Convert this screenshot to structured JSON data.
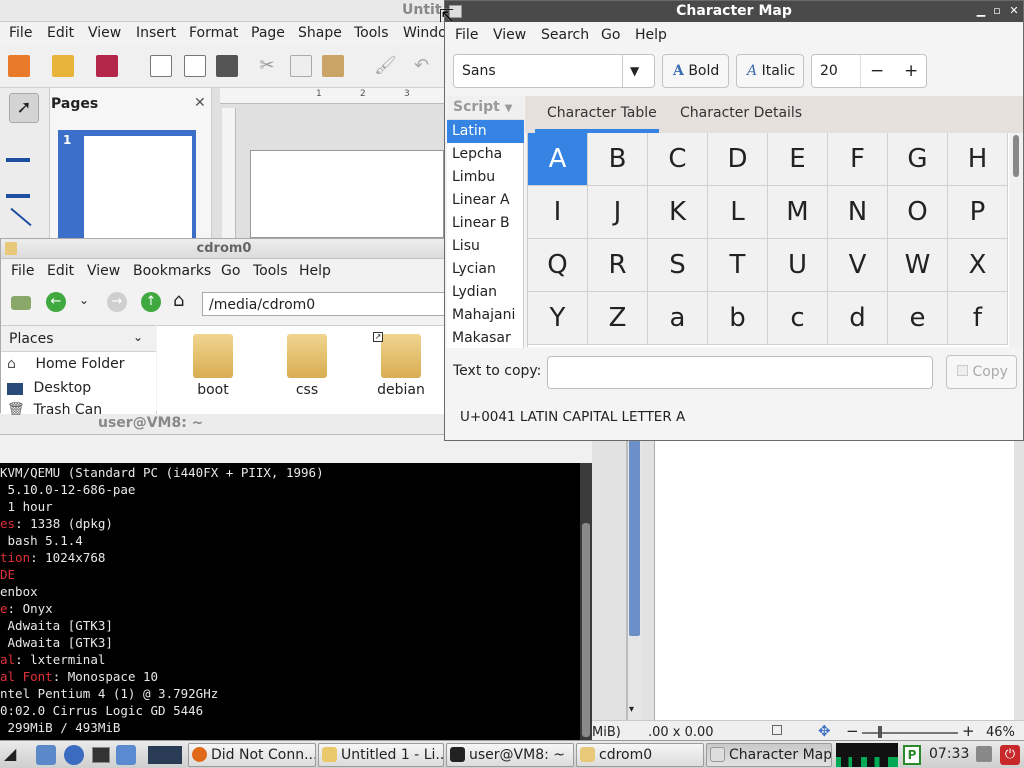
{
  "draw": {
    "title": "Untit",
    "menu": [
      "File",
      "Edit",
      "View",
      "Insert",
      "Format",
      "Page",
      "Shape",
      "Tools",
      "Windo"
    ],
    "pages_label": "Pages",
    "page_number": "1",
    "ruler": [
      "1",
      "2",
      "3"
    ],
    "status_coords": ".00 x 0.00",
    "status_partial": "MiB)",
    "zoom": "46%"
  },
  "terminal": {
    "title": "user@VM8: ~",
    "lines": [
      {
        "key": "",
        "val": "KVM/QEMU (Standard PC (i440FX + PIIX, 1996)"
      },
      {
        "key": "",
        "val": " 5.10.0-12-686-pae"
      },
      {
        "key": "",
        "val": " 1 hour"
      },
      {
        "key": "es",
        "val": ": 1338 (dpkg)"
      },
      {
        "key": "",
        "val": " bash 5.1.4"
      },
      {
        "key": "tion",
        "val": ": 1024x768"
      },
      {
        "key": "DE",
        "val": ""
      },
      {
        "key": "",
        "val": "enbox"
      },
      {
        "key": "e",
        "val": ": Onyx"
      },
      {
        "key": "",
        "val": " Adwaita [GTK3]"
      },
      {
        "key": "",
        "val": " Adwaita [GTK3]"
      },
      {
        "key": "al",
        "val": ": lxterminal"
      },
      {
        "key": "al Font",
        "val": ": Monospace 10"
      },
      {
        "key": "",
        "val": "ntel Pentium 4 (1) @ 3.792GHz"
      },
      {
        "key": "",
        "val": "0:02.0 Cirrus Logic GD 5446"
      },
      {
        "key": "",
        "val": " 299MiB / 493MiB"
      }
    ]
  },
  "filemanager": {
    "title": "cdrom0",
    "menu": [
      "File",
      "Edit",
      "View",
      "Bookmarks",
      "Go",
      "Tools",
      "Help"
    ],
    "address": "/media/cdrom0",
    "places_label": "Places",
    "places": [
      "Home Folder",
      "Desktop",
      "Trash Can"
    ],
    "files": [
      "boot",
      "css",
      "debian"
    ]
  },
  "charmap": {
    "title": "Character Map",
    "menu": [
      "File",
      "View",
      "Search",
      "Go",
      "Help"
    ],
    "font": "Sans",
    "bold_label": "Bold",
    "italic_label": "Italic",
    "size": "20",
    "minus": "−",
    "plus": "+",
    "script_label": "Script",
    "scripts": [
      "Latin",
      "Lepcha",
      "Limbu",
      "Linear A",
      "Linear B",
      "Lisu",
      "Lycian",
      "Lydian",
      "Mahajani",
      "Makasar"
    ],
    "selected_script": 0,
    "tabs": [
      "Character Table",
      "Character Details"
    ],
    "chars": [
      "A",
      "B",
      "C",
      "D",
      "E",
      "F",
      "G",
      "H",
      "I",
      "J",
      "K",
      "L",
      "M",
      "N",
      "O",
      "P",
      "Q",
      "R",
      "S",
      "T",
      "U",
      "V",
      "W",
      "X",
      "Y",
      "Z",
      "a",
      "b",
      "c",
      "d",
      "e",
      "f"
    ],
    "selected_char": 0,
    "text_to_copy_label": "Text to copy:",
    "text_to_copy_value": "",
    "copy_label": "Copy",
    "char_info": "U+0041 LATIN CAPITAL LETTER A"
  },
  "taskbar": {
    "items": [
      "Did Not Conn...",
      "Untitled 1 - Li...",
      "user@VM8: ~",
      "cdrom0",
      "Character Map"
    ],
    "active": 4,
    "clock": "07:33"
  }
}
